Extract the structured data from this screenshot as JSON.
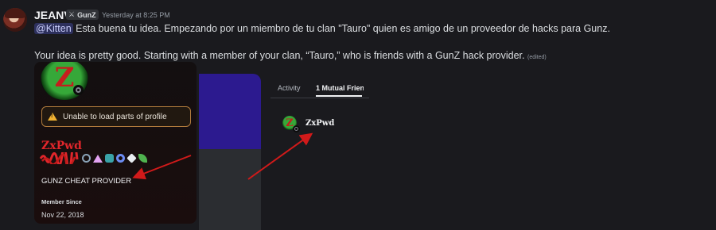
{
  "message": {
    "username": "JEANV",
    "tag": "GunZ",
    "timestamp": "Yesterday at 8:25 PM",
    "mention": "@Kitten",
    "line1": " Esta buena tu idea. Empezando por un miembro de tu clan \"Tauro\" quien es amigo de un proveedor de hacks para Gunz.",
    "line2": "Your idea is pretty good. Starting with a member of your clan, “Tauro,” who is friends with a GunZ hack provider.",
    "edited": "(edited)"
  },
  "profile_card": {
    "avatar_letter": "Z",
    "warning": "Unable to load parts of profile",
    "name": "ZxPwd",
    "bio": "GUNZ CHEAT PROVIDER",
    "member_since_label": "Member Since",
    "member_since_date": "Nov 22, 2018"
  },
  "mutual_panel": {
    "tab_activity": "Activity",
    "tab_mutual": "1 Mutual Frien",
    "friend_name": "ZxPwd",
    "avatar_letter": "Z"
  },
  "colors": {
    "background": "#1a1a1e",
    "banner": "#2c1a8f",
    "warning_border": "#b07a3c",
    "name_red": "#e1262b",
    "arrow": "#d11a1a"
  },
  "icons": [
    "sword-icon",
    "warning-icon",
    "status-offline-icon",
    "nitro-badge-icon",
    "hypesquad-badge-icon",
    "leaf-badge-icon"
  ]
}
